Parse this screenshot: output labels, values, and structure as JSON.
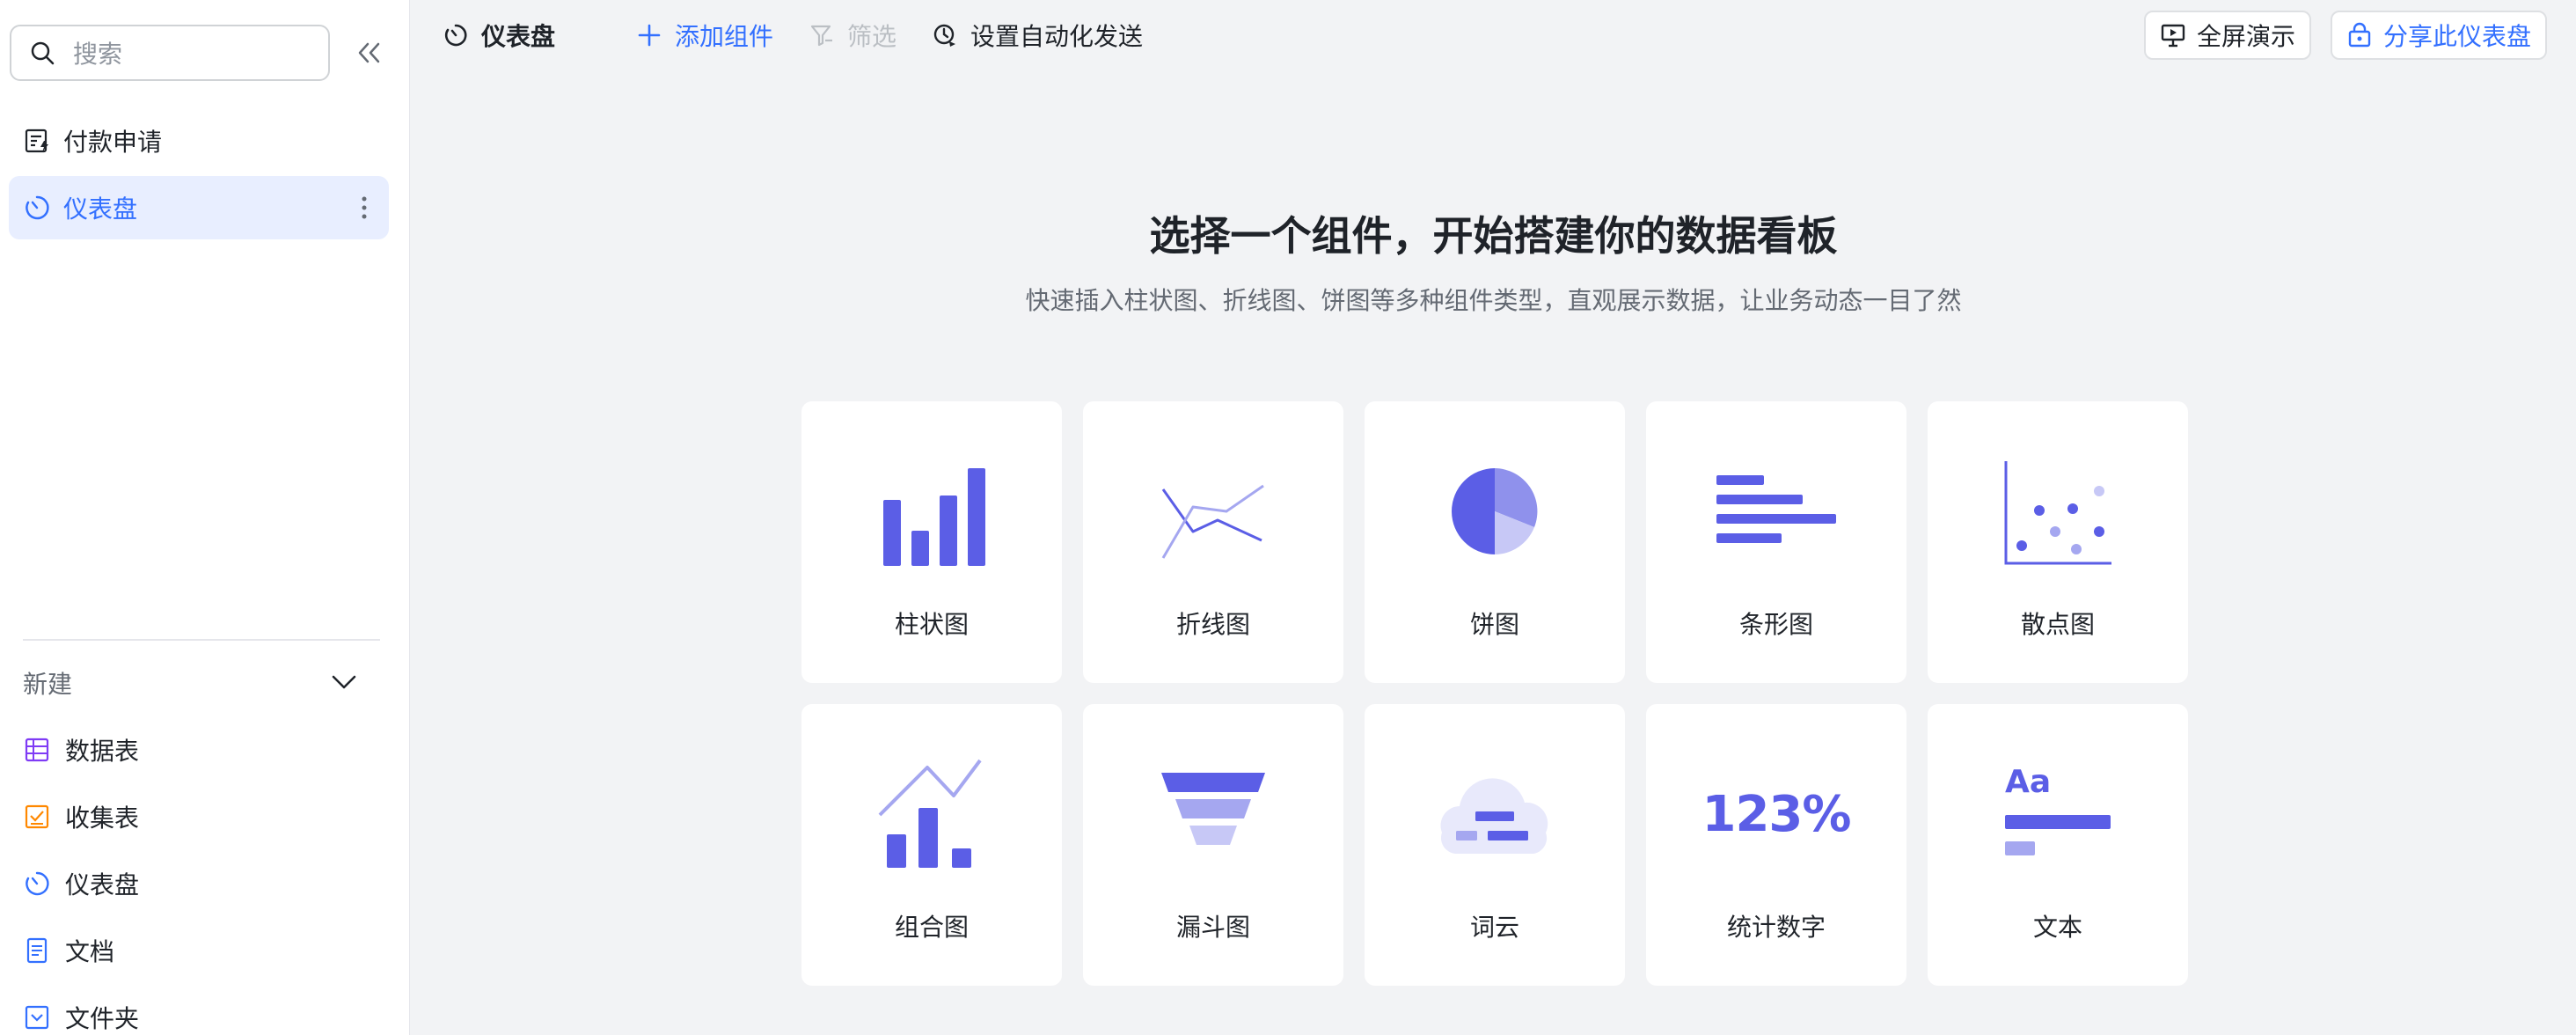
{
  "sidebar": {
    "search_placeholder": "搜索",
    "items": [
      {
        "label": "付款申请",
        "icon": "form-icon"
      },
      {
        "label": "仪表盘",
        "icon": "dashboard-icon"
      }
    ],
    "new_label": "新建",
    "new_items": [
      {
        "label": "数据表",
        "icon": "table-icon",
        "color": "#7f3bf5"
      },
      {
        "label": "收集表",
        "icon": "form-collect-icon",
        "color": "#ff8800"
      },
      {
        "label": "仪表盘",
        "icon": "dashboard-icon",
        "color": "#3370ff"
      },
      {
        "label": "文档",
        "icon": "doc-icon",
        "color": "#3370ff"
      },
      {
        "label": "文件夹",
        "icon": "folder-icon",
        "color": "#3370ff"
      }
    ]
  },
  "topbar": {
    "title": "仪表盘",
    "add_component": "添加组件",
    "filter": "筛选",
    "auto_send": "设置自动化发送",
    "fullscreen": "全屏演示",
    "share": "分享此仪表盘"
  },
  "main": {
    "title": "选择一个组件，开始搭建你的数据看板",
    "subtitle": "快速插入柱状图、折线图、饼图等多种组件类型，直观展示数据，让业务动态一目了然",
    "components": [
      {
        "label": "柱状图",
        "icon": "bar-chart-icon"
      },
      {
        "label": "折线图",
        "icon": "line-chart-icon"
      },
      {
        "label": "饼图",
        "icon": "pie-chart-icon"
      },
      {
        "label": "条形图",
        "icon": "horizontal-bar-chart-icon"
      },
      {
        "label": "散点图",
        "icon": "scatter-chart-icon"
      },
      {
        "label": "组合图",
        "icon": "combo-chart-icon"
      },
      {
        "label": "漏斗图",
        "icon": "funnel-chart-icon"
      },
      {
        "label": "词云",
        "icon": "word-cloud-icon"
      },
      {
        "label": "统计数字",
        "icon": "statistic-number-icon",
        "art_text": "123%"
      },
      {
        "label": "文本",
        "icon": "text-icon",
        "art_text": "Aa"
      }
    ]
  },
  "colors": {
    "accent": "#3370ff",
    "chart": "#5b5ee6",
    "chart_light": "#a5a7f0",
    "sidebar_active_bg": "#e8eeff"
  }
}
